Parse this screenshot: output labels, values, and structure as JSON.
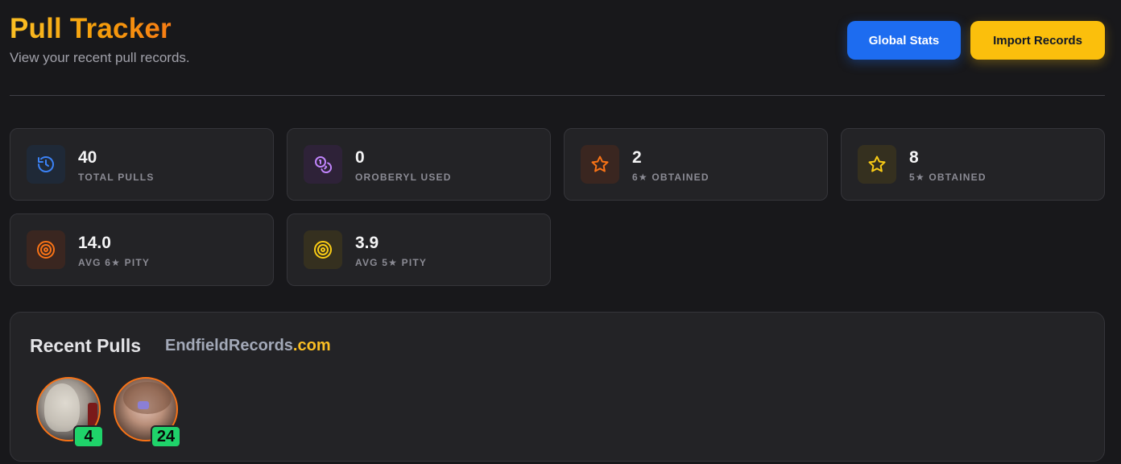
{
  "header": {
    "title": "Pull Tracker",
    "subtitle": "View your recent pull records."
  },
  "actions": {
    "global_stats": "Global Stats",
    "import_records": "Import Records"
  },
  "stats": [
    {
      "value": "40",
      "label": "TOTAL PULLS",
      "icon": "history-icon",
      "color": "#3b82f6"
    },
    {
      "value": "0",
      "label": "OROBERYL USED",
      "icon": "coins-icon",
      "color": "#c084fc"
    },
    {
      "value": "2",
      "label": "6★ OBTAINED",
      "icon": "star-icon",
      "color": "#f97316"
    },
    {
      "value": "8",
      "label": "5★ OBTAINED",
      "icon": "star-icon",
      "color": "#facc15"
    },
    {
      "value": "14.0",
      "label": "AVG 6★ PITY",
      "icon": "target-icon",
      "color": "#f97316"
    },
    {
      "value": "3.9",
      "label": "AVG 5★ PITY",
      "icon": "target-icon",
      "color": "#facc15"
    }
  ],
  "recent": {
    "title": "Recent Pulls",
    "brand_main": "EndfieldRecords",
    "brand_tld": ".com",
    "pulls": [
      {
        "pity": "4",
        "avatar": "character-portrait"
      },
      {
        "pity": "24",
        "avatar": "character-portrait"
      }
    ]
  },
  "colors": {
    "accent_blue": "#1d6cf0",
    "accent_yellow": "#fbbf0c",
    "six_star": "#f97316",
    "badge_green": "#1fd36a"
  }
}
